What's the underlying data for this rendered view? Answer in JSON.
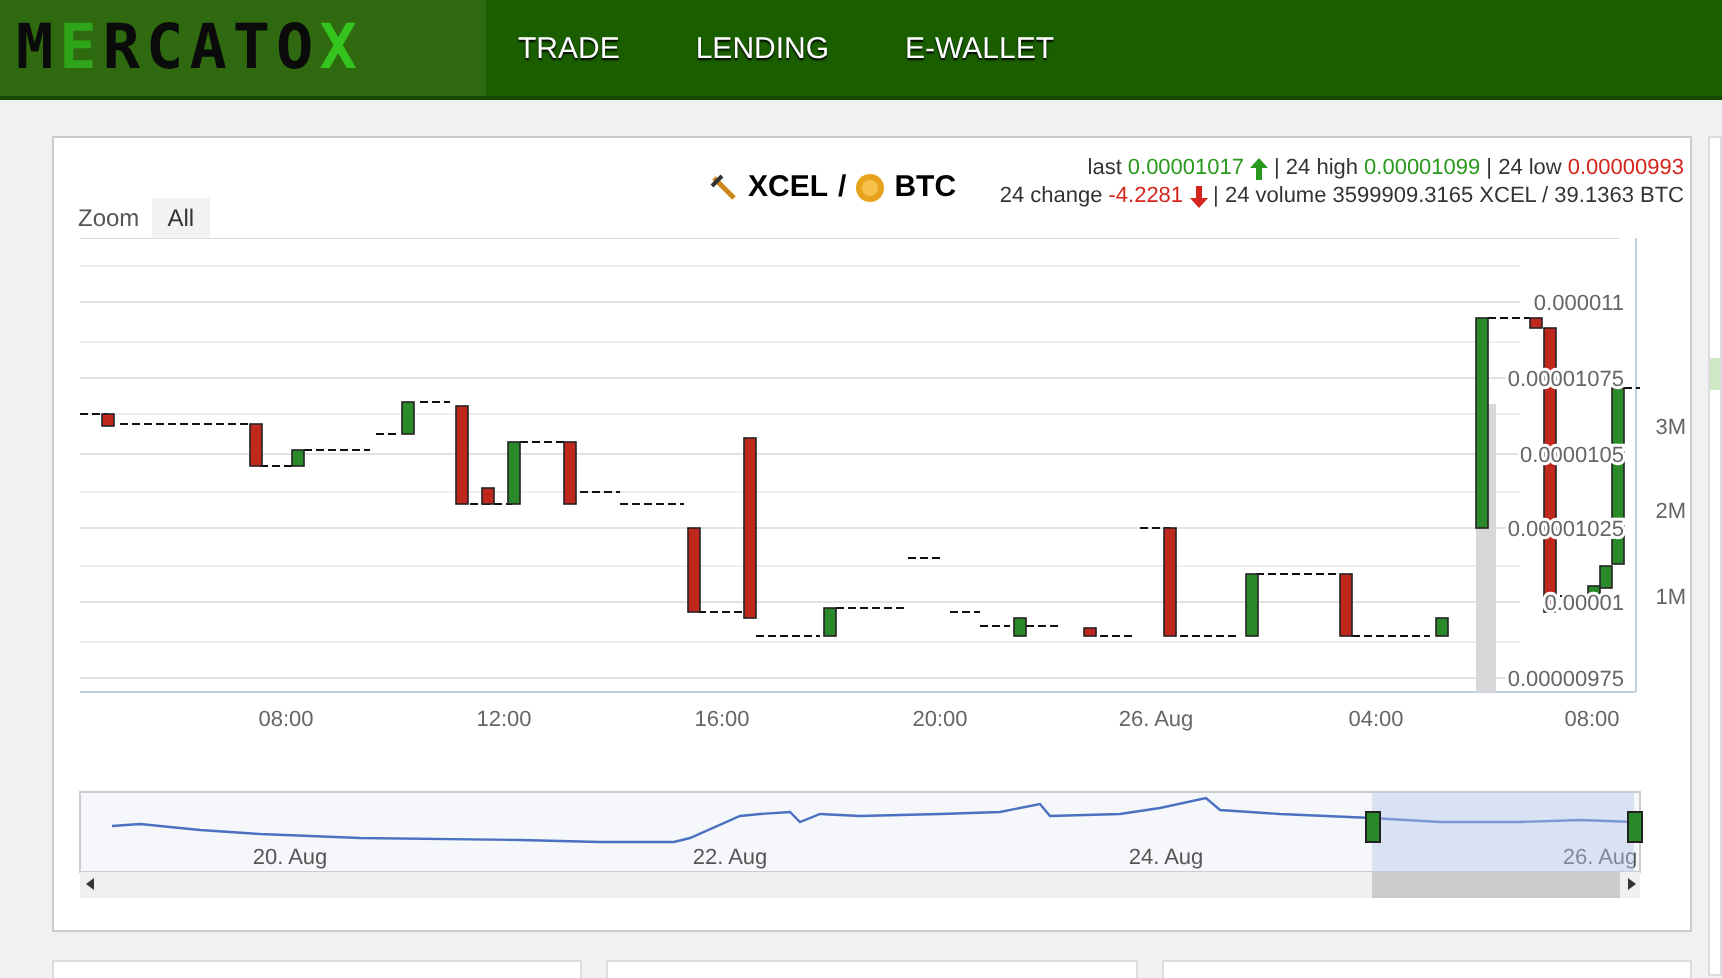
{
  "header": {
    "logo": "MERCATOX",
    "nav": [
      {
        "label": "TRADE"
      },
      {
        "label": "LENDING"
      },
      {
        "label": "E-WALLET"
      }
    ]
  },
  "chart": {
    "zoom_label": "Zoom",
    "zoom_buttons": [
      {
        "label": "All",
        "selected": true
      }
    ],
    "pair": {
      "base": "XCEL",
      "separator": "/",
      "quote": "BTC"
    },
    "stats": [
      [
        {
          "kind": "text",
          "text": "last"
        },
        {
          "kind": "up",
          "text": "0.00001017",
          "arrow": true
        },
        {
          "kind": "text",
          "text": "| 24 high"
        },
        {
          "kind": "up",
          "text": "0.00001099"
        },
        {
          "kind": "text",
          "text": "| 24 low"
        },
        {
          "kind": "down",
          "text": "0.00000993"
        }
      ],
      [
        {
          "kind": "text",
          "text": "24 change"
        },
        {
          "kind": "down",
          "text": "-4.2281",
          "arrow": true
        },
        {
          "kind": "text",
          "text": "| 24 volume 3599909.3165 XCEL / 39.1363 BTC"
        }
      ]
    ],
    "price_ticks": [
      "0.000011",
      "0.00001075",
      "0.0000105",
      "0.00001025",
      "0.00001",
      "0.00000975"
    ],
    "volume_ticks": [
      "3M",
      "2M",
      "1M"
    ],
    "time_ticks": [
      "08:00",
      "12:00",
      "16:00",
      "20:00",
      "26. Aug",
      "04:00",
      "08:00"
    ],
    "navigator_ticks": [
      "20. Aug",
      "22. Aug",
      "24. Aug",
      "26. Aug"
    ]
  }
}
